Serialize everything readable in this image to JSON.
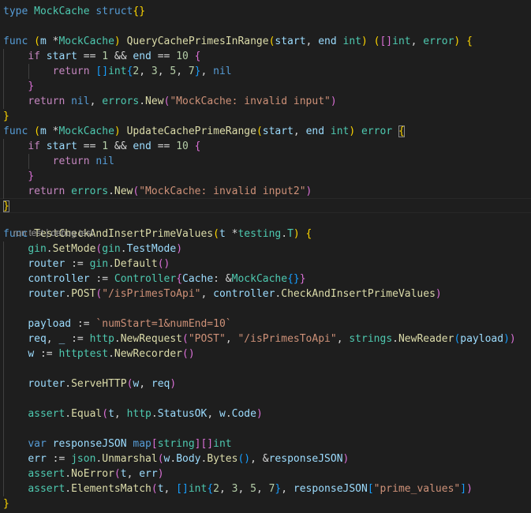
{
  "editor": {
    "language": "go",
    "codelens": {
      "run_test": "run test",
      "separator": " | ",
      "debug_test": "debug test"
    },
    "lines": [
      [
        [
          "kw",
          "type"
        ],
        [
          "tx",
          " "
        ],
        [
          "ty",
          "MockCache"
        ],
        [
          "tx",
          " "
        ],
        [
          "kw",
          "struct"
        ],
        [
          "b1",
          "{}"
        ]
      ],
      [],
      [
        [
          "kw",
          "func"
        ],
        [
          "tx",
          " "
        ],
        [
          "b1",
          "("
        ],
        [
          "vr",
          "m"
        ],
        [
          "tx",
          " *"
        ],
        [
          "ty",
          "MockCache"
        ],
        [
          "b1",
          ")"
        ],
        [
          "tx",
          " "
        ],
        [
          "fn",
          "QueryCachePrimesInRange"
        ],
        [
          "b1",
          "("
        ],
        [
          "vr",
          "start"
        ],
        [
          "tx",
          ", "
        ],
        [
          "vr",
          "end"
        ],
        [
          "tx",
          " "
        ],
        [
          "ty",
          "int"
        ],
        [
          "b1",
          ")"
        ],
        [
          "tx",
          " "
        ],
        [
          "b1",
          "("
        ],
        [
          "b2",
          "[]"
        ],
        [
          "ty",
          "int"
        ],
        [
          "tx",
          ", "
        ],
        [
          "ty",
          "error"
        ],
        [
          "b1",
          ")"
        ],
        [
          "tx",
          " "
        ],
        [
          "b1",
          "{"
        ]
      ],
      [
        [
          "tx",
          "    "
        ],
        [
          "ct",
          "if"
        ],
        [
          "tx",
          " "
        ],
        [
          "vr",
          "start"
        ],
        [
          "tx",
          " == "
        ],
        [
          "nm",
          "1"
        ],
        [
          "tx",
          " && "
        ],
        [
          "vr",
          "end"
        ],
        [
          "tx",
          " == "
        ],
        [
          "nm",
          "10"
        ],
        [
          "tx",
          " "
        ],
        [
          "b2",
          "{"
        ]
      ],
      [
        [
          "tx",
          "        "
        ],
        [
          "ct",
          "return"
        ],
        [
          "tx",
          " "
        ],
        [
          "b3",
          "[]"
        ],
        [
          "ty",
          "int"
        ],
        [
          "b3",
          "{"
        ],
        [
          "nm",
          "2"
        ],
        [
          "tx",
          ", "
        ],
        [
          "nm",
          "3"
        ],
        [
          "tx",
          ", "
        ],
        [
          "nm",
          "5"
        ],
        [
          "tx",
          ", "
        ],
        [
          "nm",
          "7"
        ],
        [
          "b3",
          "}"
        ],
        [
          "tx",
          ", "
        ],
        [
          "kw",
          "nil"
        ]
      ],
      [
        [
          "tx",
          "    "
        ],
        [
          "b2",
          "}"
        ]
      ],
      [
        [
          "tx",
          "    "
        ],
        [
          "ct",
          "return"
        ],
        [
          "tx",
          " "
        ],
        [
          "kw",
          "nil"
        ],
        [
          "tx",
          ", "
        ],
        [
          "ty",
          "errors"
        ],
        [
          "tx",
          "."
        ],
        [
          "fn",
          "New"
        ],
        [
          "b2",
          "("
        ],
        [
          "st",
          "\"MockCache: invalid input\""
        ],
        [
          "b2",
          ")"
        ]
      ],
      [
        [
          "b1",
          "}"
        ]
      ],
      [
        [
          "kw",
          "func"
        ],
        [
          "tx",
          " "
        ],
        [
          "b1",
          "("
        ],
        [
          "vr",
          "m"
        ],
        [
          "tx",
          " *"
        ],
        [
          "ty",
          "MockCache"
        ],
        [
          "b1",
          ")"
        ],
        [
          "tx",
          " "
        ],
        [
          "fn",
          "UpdateCachePrimeRange"
        ],
        [
          "b1",
          "("
        ],
        [
          "vr",
          "start"
        ],
        [
          "tx",
          ", "
        ],
        [
          "vr",
          "end"
        ],
        [
          "tx",
          " "
        ],
        [
          "ty",
          "int"
        ],
        [
          "b1",
          ")"
        ],
        [
          "tx",
          " "
        ],
        [
          "ty",
          "error"
        ],
        [
          "tx",
          " "
        ],
        [
          "b1",
          "{",
          "bm"
        ]
      ],
      [
        [
          "tx",
          "    "
        ],
        [
          "ct",
          "if"
        ],
        [
          "tx",
          " "
        ],
        [
          "vr",
          "start"
        ],
        [
          "tx",
          " == "
        ],
        [
          "nm",
          "1"
        ],
        [
          "tx",
          " && "
        ],
        [
          "vr",
          "end"
        ],
        [
          "tx",
          " == "
        ],
        [
          "nm",
          "10"
        ],
        [
          "tx",
          " "
        ],
        [
          "b2",
          "{"
        ]
      ],
      [
        [
          "tx",
          "        "
        ],
        [
          "ct",
          "return"
        ],
        [
          "tx",
          " "
        ],
        [
          "kw",
          "nil"
        ]
      ],
      [
        [
          "tx",
          "    "
        ],
        [
          "b2",
          "}"
        ]
      ],
      [
        [
          "tx",
          "    "
        ],
        [
          "ct",
          "return"
        ],
        [
          "tx",
          " "
        ],
        [
          "ty",
          "errors"
        ],
        [
          "tx",
          "."
        ],
        [
          "fn",
          "New"
        ],
        [
          "b2",
          "("
        ],
        [
          "st",
          "\"MockCache: invalid input2\""
        ],
        [
          "b2",
          ")"
        ]
      ],
      [
        [
          "b1",
          "}",
          "bm"
        ]
      ],
      [
        [
          "kw",
          "func"
        ],
        [
          "tx",
          " "
        ],
        [
          "fn",
          "TestCheckAndInsertPrimeValues"
        ],
        [
          "b1",
          "("
        ],
        [
          "vr",
          "t"
        ],
        [
          "tx",
          " *"
        ],
        [
          "ty",
          "testing"
        ],
        [
          "tx",
          "."
        ],
        [
          "ty",
          "T"
        ],
        [
          "b1",
          ")"
        ],
        [
          "tx",
          " "
        ],
        [
          "b1",
          "{"
        ]
      ],
      [
        [
          "tx",
          "    "
        ],
        [
          "ty",
          "gin"
        ],
        [
          "tx",
          "."
        ],
        [
          "fn",
          "SetMode"
        ],
        [
          "b2",
          "("
        ],
        [
          "ty",
          "gin"
        ],
        [
          "tx",
          "."
        ],
        [
          "vr",
          "TestMode"
        ],
        [
          "b2",
          ")"
        ]
      ],
      [
        [
          "tx",
          "    "
        ],
        [
          "vr",
          "router"
        ],
        [
          "tx",
          " := "
        ],
        [
          "ty",
          "gin"
        ],
        [
          "tx",
          "."
        ],
        [
          "fn",
          "Default"
        ],
        [
          "b2",
          "()"
        ]
      ],
      [
        [
          "tx",
          "    "
        ],
        [
          "vr",
          "controller"
        ],
        [
          "tx",
          " := "
        ],
        [
          "ty",
          "Controller"
        ],
        [
          "b2",
          "{"
        ],
        [
          "vr",
          "Cache"
        ],
        [
          "tx",
          ": &"
        ],
        [
          "ty",
          "MockCache"
        ],
        [
          "b3",
          "{}"
        ],
        [
          "b2",
          "}"
        ]
      ],
      [
        [
          "tx",
          "    "
        ],
        [
          "vr",
          "router"
        ],
        [
          "tx",
          "."
        ],
        [
          "fn",
          "POST"
        ],
        [
          "b2",
          "("
        ],
        [
          "st",
          "\"/isPrimesToApi\""
        ],
        [
          "tx",
          ", "
        ],
        [
          "vr",
          "controller"
        ],
        [
          "tx",
          "."
        ],
        [
          "fn",
          "CheckAndInsertPrimeValues"
        ],
        [
          "b2",
          ")"
        ]
      ],
      [],
      [
        [
          "tx",
          "    "
        ],
        [
          "vr",
          "payload"
        ],
        [
          "tx",
          " := "
        ],
        [
          "st",
          "`numStart=1&numEnd=10`"
        ]
      ],
      [
        [
          "tx",
          "    "
        ],
        [
          "vr",
          "req"
        ],
        [
          "tx",
          ", "
        ],
        [
          "vr",
          "_"
        ],
        [
          "tx",
          " := "
        ],
        [
          "ty",
          "http"
        ],
        [
          "tx",
          "."
        ],
        [
          "fn",
          "NewRequest"
        ],
        [
          "b2",
          "("
        ],
        [
          "st",
          "\"POST\""
        ],
        [
          "tx",
          ", "
        ],
        [
          "st",
          "\"/isPrimesToApi\""
        ],
        [
          "tx",
          ", "
        ],
        [
          "ty",
          "strings"
        ],
        [
          "tx",
          "."
        ],
        [
          "fn",
          "NewReader"
        ],
        [
          "b3",
          "("
        ],
        [
          "vr",
          "payload"
        ],
        [
          "b3",
          ")"
        ],
        [
          "b2",
          ")"
        ]
      ],
      [
        [
          "tx",
          "    "
        ],
        [
          "vr",
          "w"
        ],
        [
          "tx",
          " := "
        ],
        [
          "ty",
          "httptest"
        ],
        [
          "tx",
          "."
        ],
        [
          "fn",
          "NewRecorder"
        ],
        [
          "b2",
          "()"
        ]
      ],
      [],
      [
        [
          "tx",
          "    "
        ],
        [
          "vr",
          "router"
        ],
        [
          "tx",
          "."
        ],
        [
          "fn",
          "ServeHTTP"
        ],
        [
          "b2",
          "("
        ],
        [
          "vr",
          "w"
        ],
        [
          "tx",
          ", "
        ],
        [
          "vr",
          "req"
        ],
        [
          "b2",
          ")"
        ]
      ],
      [],
      [
        [
          "tx",
          "    "
        ],
        [
          "ty",
          "assert"
        ],
        [
          "tx",
          "."
        ],
        [
          "fn",
          "Equal"
        ],
        [
          "b2",
          "("
        ],
        [
          "vr",
          "t"
        ],
        [
          "tx",
          ", "
        ],
        [
          "ty",
          "http"
        ],
        [
          "tx",
          "."
        ],
        [
          "vr",
          "StatusOK"
        ],
        [
          "tx",
          ", "
        ],
        [
          "vr",
          "w"
        ],
        [
          "tx",
          "."
        ],
        [
          "vr",
          "Code"
        ],
        [
          "b2",
          ")"
        ]
      ],
      [],
      [
        [
          "tx",
          "    "
        ],
        [
          "kw",
          "var"
        ],
        [
          "tx",
          " "
        ],
        [
          "vr",
          "responseJSON"
        ],
        [
          "tx",
          " "
        ],
        [
          "kw",
          "map"
        ],
        [
          "b2",
          "["
        ],
        [
          "ty",
          "string"
        ],
        [
          "b2",
          "]"
        ],
        [
          "b2",
          "[]"
        ],
        [
          "ty",
          "int"
        ]
      ],
      [
        [
          "tx",
          "    "
        ],
        [
          "vr",
          "err"
        ],
        [
          "tx",
          " := "
        ],
        [
          "ty",
          "json"
        ],
        [
          "tx",
          "."
        ],
        [
          "fn",
          "Unmarshal"
        ],
        [
          "b2",
          "("
        ],
        [
          "vr",
          "w"
        ],
        [
          "tx",
          "."
        ],
        [
          "vr",
          "Body"
        ],
        [
          "tx",
          "."
        ],
        [
          "fn",
          "Bytes"
        ],
        [
          "b3",
          "()"
        ],
        [
          "tx",
          ", &"
        ],
        [
          "vr",
          "responseJSON"
        ],
        [
          "b2",
          ")"
        ]
      ],
      [
        [
          "tx",
          "    "
        ],
        [
          "ty",
          "assert"
        ],
        [
          "tx",
          "."
        ],
        [
          "fn",
          "NoError"
        ],
        [
          "b2",
          "("
        ],
        [
          "vr",
          "t"
        ],
        [
          "tx",
          ", "
        ],
        [
          "vr",
          "err"
        ],
        [
          "b2",
          ")"
        ]
      ],
      [
        [
          "tx",
          "    "
        ],
        [
          "ty",
          "assert"
        ],
        [
          "tx",
          "."
        ],
        [
          "fn",
          "ElementsMatch"
        ],
        [
          "b2",
          "("
        ],
        [
          "vr",
          "t"
        ],
        [
          "tx",
          ", "
        ],
        [
          "b3",
          "[]"
        ],
        [
          "ty",
          "int"
        ],
        [
          "b3",
          "{"
        ],
        [
          "nm",
          "2"
        ],
        [
          "tx",
          ", "
        ],
        [
          "nm",
          "3"
        ],
        [
          "tx",
          ", "
        ],
        [
          "nm",
          "5"
        ],
        [
          "tx",
          ", "
        ],
        [
          "nm",
          "7"
        ],
        [
          "b3",
          "}"
        ],
        [
          "tx",
          ", "
        ],
        [
          "vr",
          "responseJSON"
        ],
        [
          "b3",
          "["
        ],
        [
          "st",
          "\"prime_values\""
        ],
        [
          "b3",
          "]"
        ],
        [
          "b2",
          ")"
        ]
      ],
      [
        [
          "b1",
          "}"
        ]
      ]
    ]
  }
}
